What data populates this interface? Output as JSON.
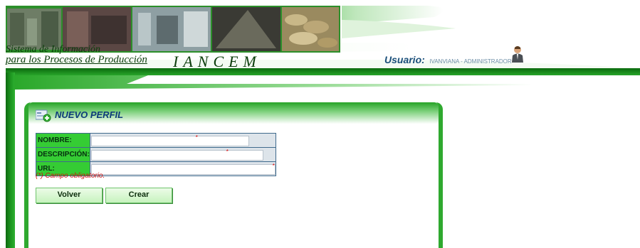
{
  "header": {
    "brand_line1": "Sistema de Información",
    "brand_line2": "para los Procesos de Producción",
    "system_name": "IANCEM",
    "user_label": "Usuario:",
    "user_name": "IVANVIANA - ADMINISTRADOR"
  },
  "panel": {
    "title": "NUEVO PERFIL",
    "fields": [
      {
        "label": "NOMBRE:",
        "value": ""
      },
      {
        "label": "DESCRIPCIÓN:",
        "value": ""
      },
      {
        "label": "URL:",
        "value": ""
      }
    ],
    "required_marker": "*",
    "required_note": "(*) Campo obligatorio."
  },
  "buttons": {
    "back": "Volver",
    "create": "Crear"
  },
  "colors": {
    "brand_green": "#1f9a22",
    "label_green": "#35cc34",
    "title_blue": "#0e3b7a",
    "required_red": "#d11010"
  },
  "icons": {
    "user": "user-person-icon",
    "panel": "new-profile-form-icon"
  }
}
